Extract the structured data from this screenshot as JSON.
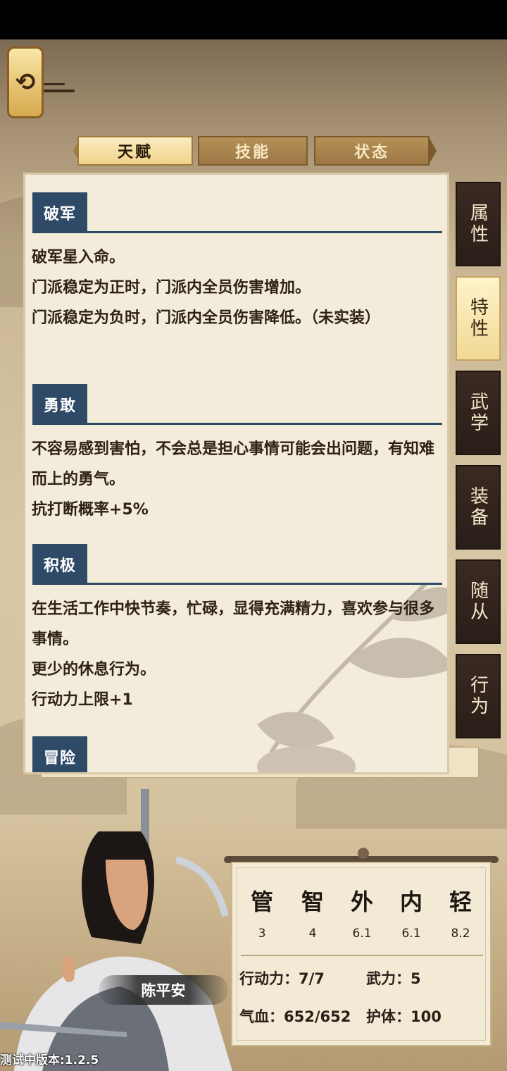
{
  "tabs": [
    {
      "label": "天赋",
      "active": true
    },
    {
      "label": "技能",
      "active": false
    },
    {
      "label": "状态",
      "active": false
    }
  ],
  "side_tabs": [
    {
      "label": "属性",
      "active": false
    },
    {
      "label": "特性",
      "active": true
    },
    {
      "label": "武学",
      "active": false
    },
    {
      "label": "装备",
      "active": false
    },
    {
      "label": "随从",
      "active": false
    },
    {
      "label": "行为",
      "active": false
    }
  ],
  "talents": [
    {
      "title": "破军",
      "lines": [
        "破军星入命。",
        "门派稳定为正时，门派内全员伤害增加。",
        "门派稳定为负时，门派内全员伤害降低。（未实装）"
      ]
    },
    {
      "title": "勇敢",
      "lines": [
        "不容易感到害怕，不会总是担心事情可能会出问题，有知难而上的勇气。",
        "抗打断概率+5%"
      ]
    },
    {
      "title": "积极",
      "lines": [
        "在生活工作中快节奏，忙碌，显得充满精力，喜欢参与很多事情。",
        "更少的休息行为。",
        "行动力上限+1"
      ]
    },
    {
      "title": "冒险",
      "lines": []
    }
  ],
  "character": {
    "name": "陈平安",
    "attributes": [
      {
        "glyph": "管",
        "value": "3"
      },
      {
        "glyph": "智",
        "value": "4"
      },
      {
        "glyph": "外",
        "value": "6.1"
      },
      {
        "glyph": "内",
        "value": "6.1"
      },
      {
        "glyph": "轻",
        "value": "8.2"
      }
    ],
    "stats": {
      "action_power": "行动力：7/7",
      "martial": "武力：5",
      "hp": "气血：652/652",
      "guard": "护体：100"
    }
  },
  "version": "测试中版本:1.2.5",
  "icons": {
    "back": "back-arrow-icon"
  },
  "colors": {
    "section_blue": "#2f4a67",
    "tab_gold": "#f0d38a",
    "side_dark": "#2a1e18"
  }
}
